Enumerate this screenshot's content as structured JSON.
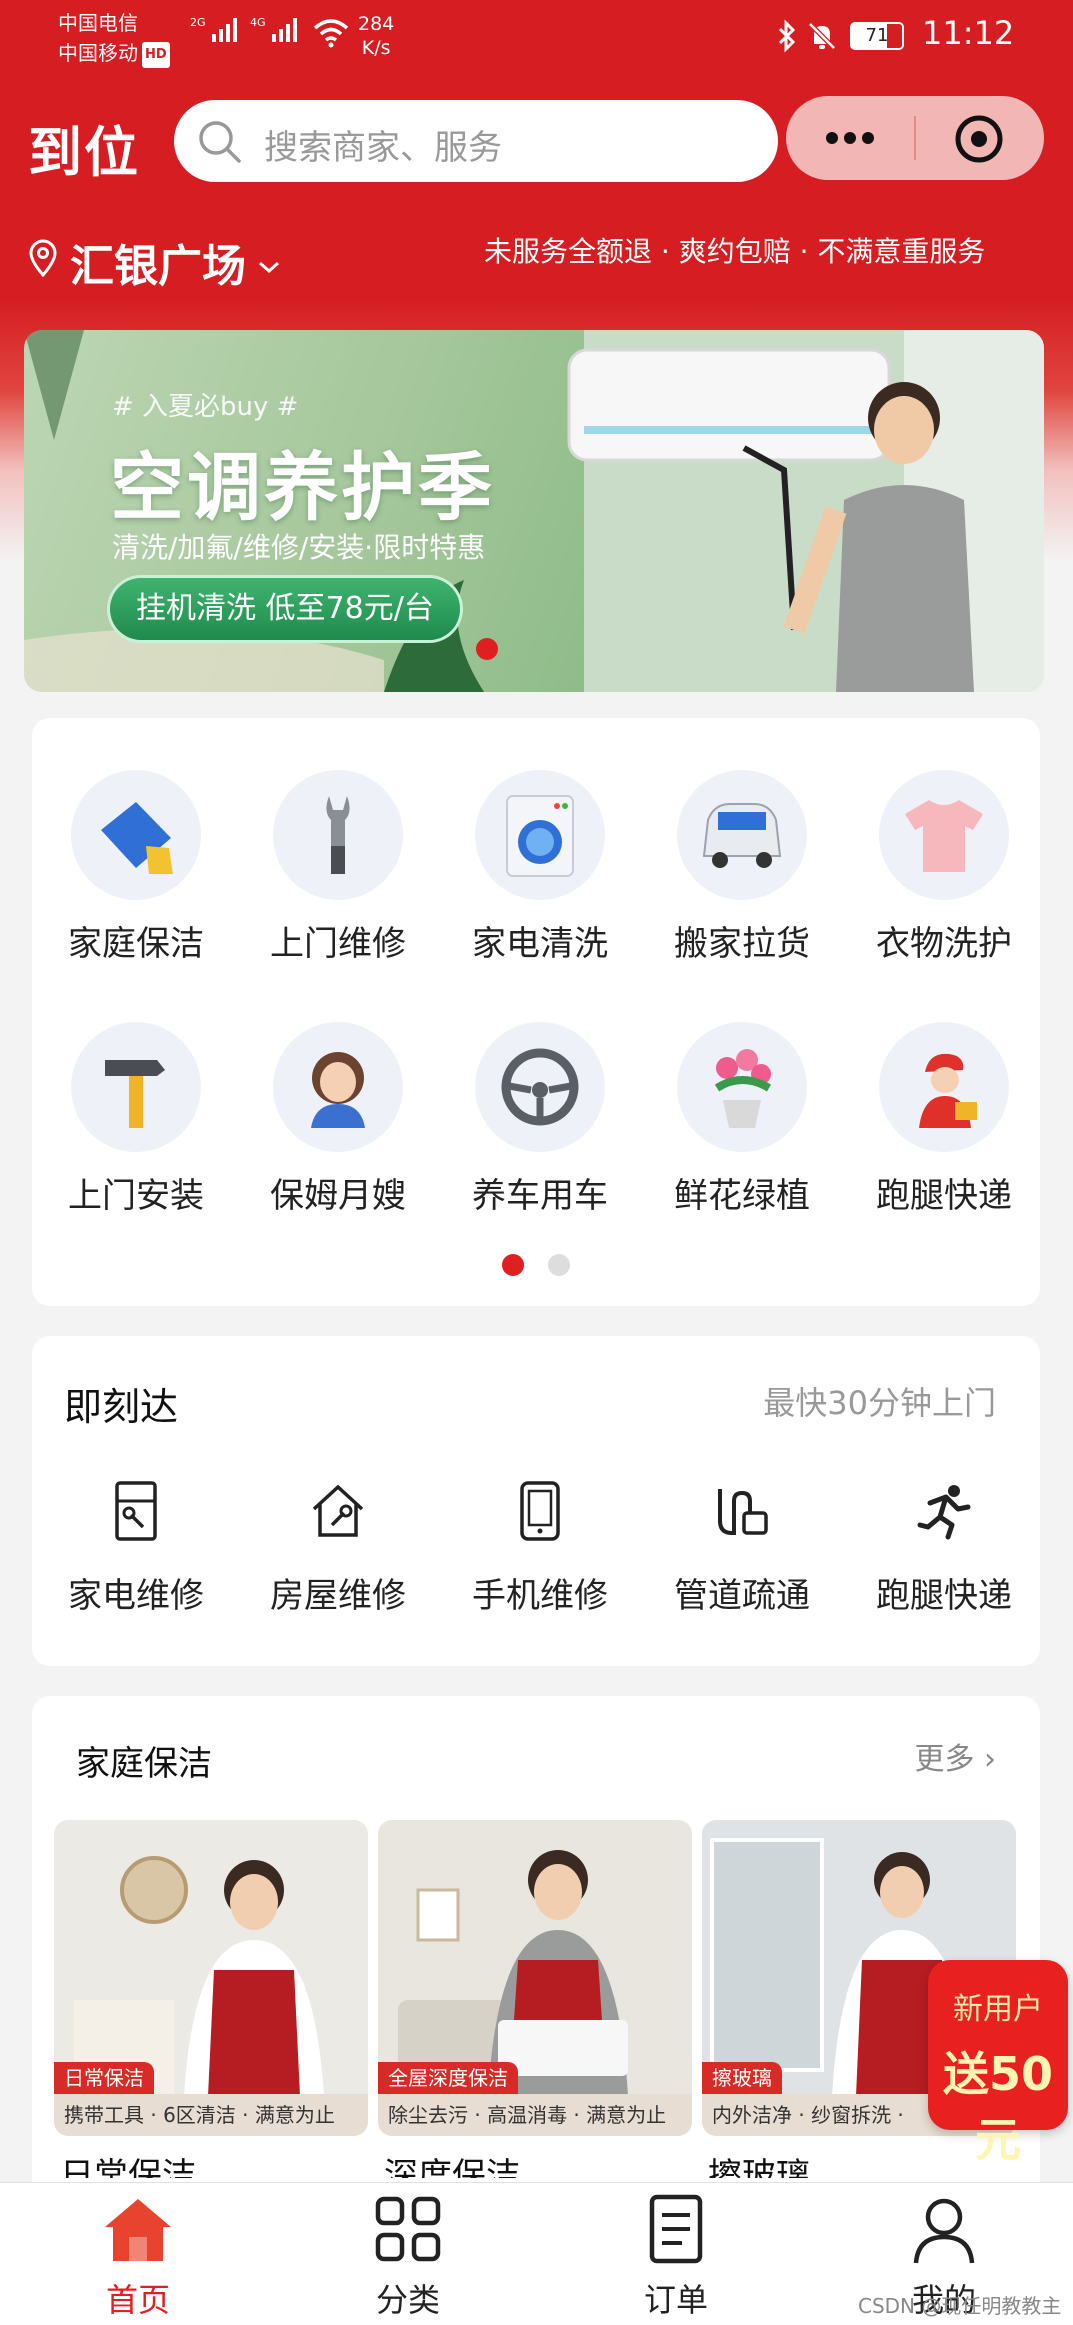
{
  "status_bar": {
    "carrier1": "中国电信",
    "carrier2": "中国移动",
    "hd": "HD",
    "sig1": "2G",
    "sig2": "4G",
    "speed_value": "284",
    "speed_unit": "K/s",
    "battery": "71",
    "time": "11:12"
  },
  "header": {
    "logo": "到位",
    "search_placeholder": "搜索商家、服务",
    "location": "汇银广场",
    "promise": "未服务全额退 · 爽约包赔 · 不满意重服务"
  },
  "banner": {
    "tag": "# 入夏必buy #",
    "title": "空调养护季",
    "subtitle": "清洗/加氟/维修/安装·限时特惠",
    "button": "挂机清洗 低至78元/台"
  },
  "categories": [
    {
      "label": "家庭保洁",
      "icon": "cleaning-cloth-icon"
    },
    {
      "label": "上门维修",
      "icon": "wrench-icon"
    },
    {
      "label": "家电清洗",
      "icon": "washing-machine-icon"
    },
    {
      "label": "搬家拉货",
      "icon": "van-icon"
    },
    {
      "label": "衣物洗护",
      "icon": "tshirt-icon"
    },
    {
      "label": "上门安装",
      "icon": "hammer-icon"
    },
    {
      "label": "保姆月嫂",
      "icon": "nanny-icon"
    },
    {
      "label": "养车用车",
      "icon": "steering-wheel-icon"
    },
    {
      "label": "鲜花绿植",
      "icon": "flower-pot-icon"
    },
    {
      "label": "跑腿快递",
      "icon": "courier-icon"
    }
  ],
  "instant": {
    "title": "即刻达",
    "subtitle": "最快30分钟上门",
    "items": [
      {
        "label": "家电维修",
        "icon": "appliance-repair-icon"
      },
      {
        "label": "房屋维修",
        "icon": "house-repair-icon"
      },
      {
        "label": "手机维修",
        "icon": "phone-icon"
      },
      {
        "label": "管道疏通",
        "icon": "pipe-icon"
      },
      {
        "label": "跑腿快递",
        "icon": "running-man-icon"
      }
    ]
  },
  "cleaning": {
    "title": "家庭保洁",
    "more": "更多",
    "cards": [
      {
        "chip": "日常保洁",
        "desc": "携带工具 · 6区清洁 · 满意为止",
        "name": "日常保洁"
      },
      {
        "chip": "全屋深度保洁",
        "desc": "除尘去污 · 高温消毒 · 满意为止",
        "name": "深度保洁"
      },
      {
        "chip": "擦玻璃",
        "desc": "内外洁净 · 纱窗拆洗 · ",
        "name": "擦玻璃"
      }
    ]
  },
  "new_user": {
    "line1": "新用户",
    "line2": "送50元"
  },
  "tabbar": [
    {
      "label": "首页",
      "icon": "home-icon",
      "active": true
    },
    {
      "label": "分类",
      "icon": "grid-icon",
      "active": false
    },
    {
      "label": "订单",
      "icon": "order-icon",
      "active": false
    },
    {
      "label": "我的",
      "icon": "user-icon",
      "active": false
    }
  ],
  "watermark": "CSDN @现任明教教主~",
  "colors": {
    "brand_red": "#d61e22",
    "active_tab": "#e02020"
  }
}
